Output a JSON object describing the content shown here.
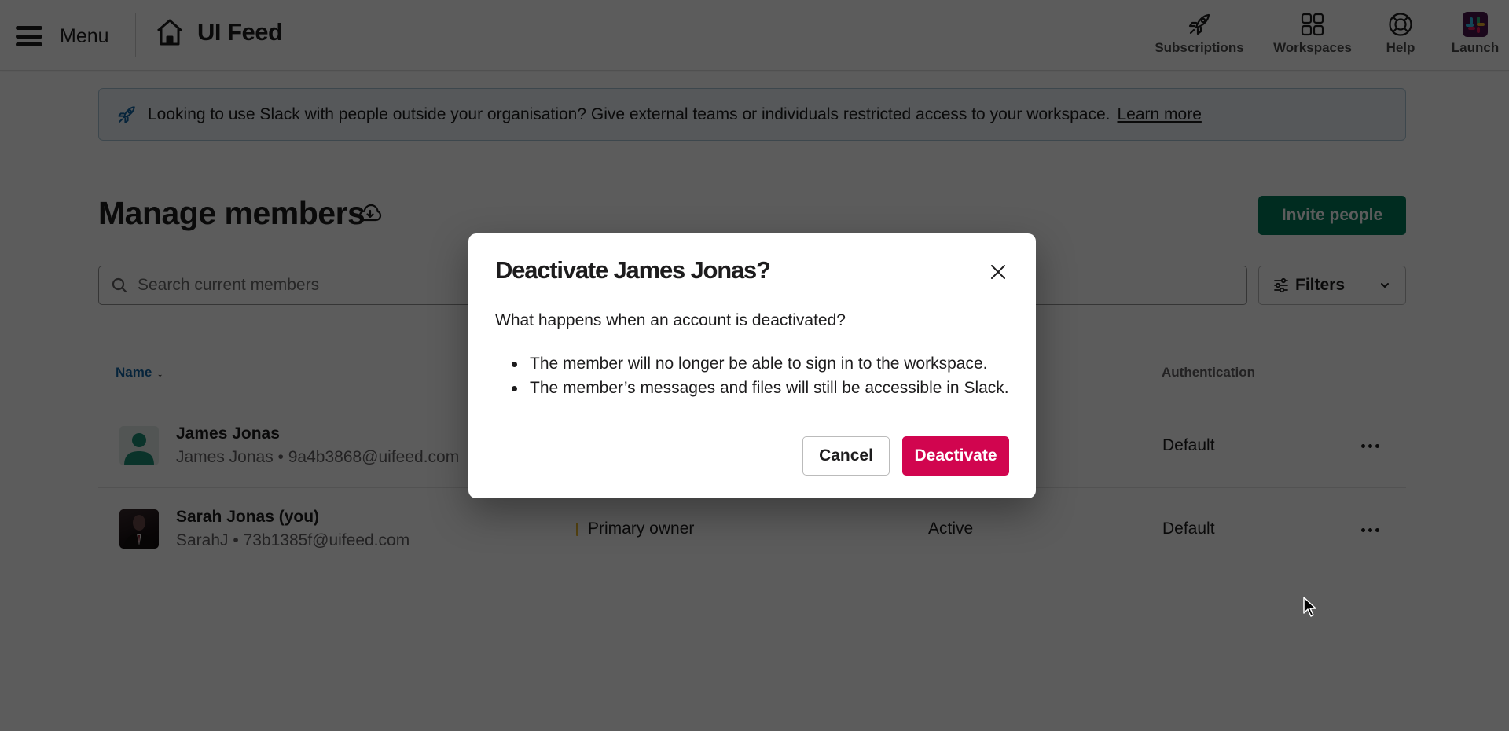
{
  "header": {
    "menu_label": "Menu",
    "home_label": "UI Feed",
    "actions": [
      {
        "label": "Subscriptions",
        "icon": "rocket-icon"
      },
      {
        "label": "Workspaces",
        "icon": "grid-icon"
      },
      {
        "label": "Help",
        "icon": "lifebuoy-icon"
      },
      {
        "label": "Launch",
        "icon": "slack-logo-icon"
      }
    ]
  },
  "banner": {
    "icon": "rocket-icon",
    "text": "Looking to use Slack with people outside your organisation? Give external teams or individuals restricted access to your workspace.",
    "link_label": "Learn more"
  },
  "page": {
    "title": "Manage members",
    "invite_label": "Invite people",
    "search_placeholder": "Search current members",
    "search_value": "",
    "filters_label": "Filters"
  },
  "table": {
    "columns": {
      "name": "Name",
      "sort_indicator": "↓",
      "authentication": "Authentication"
    },
    "rows": [
      {
        "name": "James Jonas",
        "display": "James Jonas • 9a4b3868@uifeed.com",
        "role": "",
        "status": "",
        "authentication": "Default",
        "avatar": "generic-user"
      },
      {
        "name": "Sarah Jonas (you)",
        "display": "SarahJ • 73b1385f@uifeed.com",
        "role": "Primary owner",
        "status": "Active",
        "authentication": "Default",
        "avatar": "photo"
      }
    ]
  },
  "modal": {
    "title": "Deactivate James Jonas?",
    "question": "What happens when an account is deactivated?",
    "bullets": [
      "The member will no longer be able to sign in to the workspace.",
      "The member’s messages and files will still be accessible in Slack."
    ],
    "cancel_label": "Cancel",
    "confirm_label": "Deactivate"
  },
  "colors": {
    "primary_green": "#007a5a",
    "danger": "#d1054f",
    "link_blue": "#1264a3",
    "banner_bg": "#eef4f8",
    "role_accent": "#e8b72e"
  }
}
